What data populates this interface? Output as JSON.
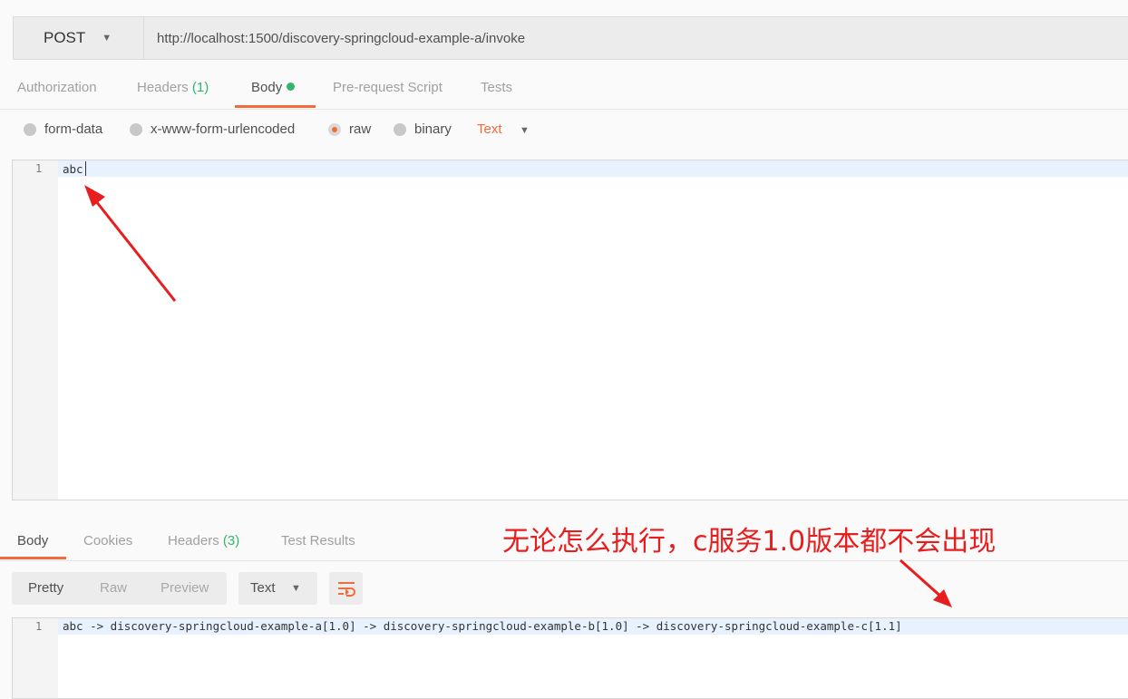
{
  "request": {
    "method": "POST",
    "url": "http://localhost:1500/discovery-springcloud-example-a/invoke"
  },
  "request_tabs": [
    {
      "label": "Authorization"
    },
    {
      "label": "Headers",
      "count": "(1)"
    },
    {
      "label": "Body",
      "active": true
    },
    {
      "label": "Pre-request Script"
    },
    {
      "label": "Tests"
    }
  ],
  "body_types": {
    "form_data": "form-data",
    "urlencoded": "x-www-form-urlencoded",
    "raw": "raw",
    "binary": "binary",
    "selected": "raw",
    "content_type": "Text"
  },
  "request_editor": {
    "line_number": "1",
    "content": "abc"
  },
  "response_tabs": [
    {
      "label": "Body",
      "active": true
    },
    {
      "label": "Cookies"
    },
    {
      "label": "Headers",
      "count": "(3)"
    },
    {
      "label": "Test Results"
    }
  ],
  "response_toolbar": {
    "pretty": "Pretty",
    "raw": "Raw",
    "preview": "Preview",
    "format": "Text"
  },
  "response_editor": {
    "line_number": "1",
    "content": "abc -> discovery-springcloud-example-a[1.0] -> discovery-springcloud-example-b[1.0] -> discovery-springcloud-example-c[1.1]"
  },
  "annotation": {
    "text": "无论怎么执行，c服务1.0版本都不会出现"
  },
  "colors": {
    "accent": "#f26b3a",
    "count_green": "#33b36b",
    "annotation_red": "#e81d1d"
  }
}
